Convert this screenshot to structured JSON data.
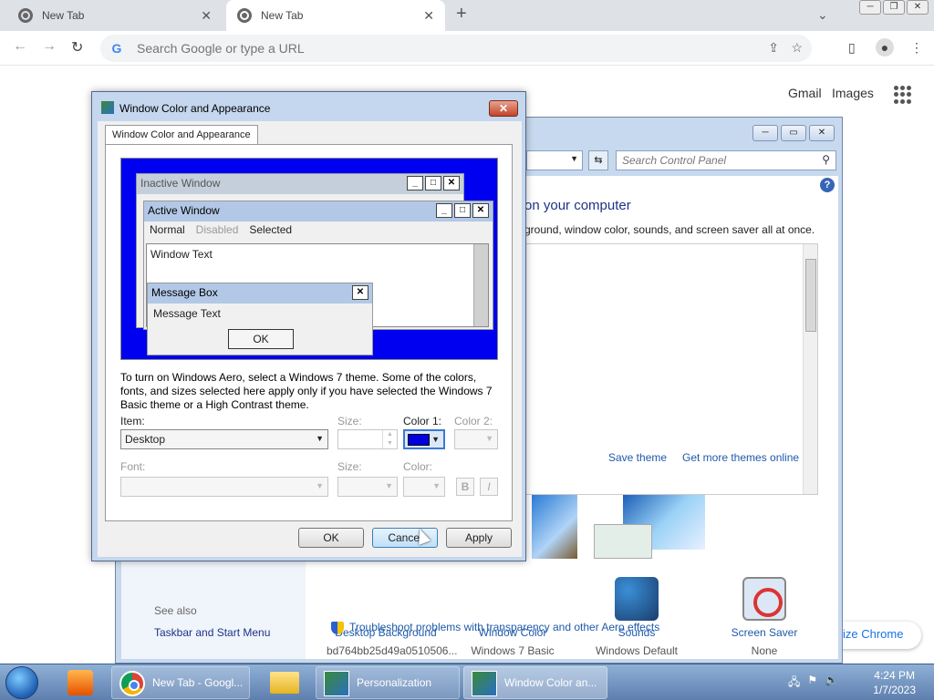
{
  "browser": {
    "tabs": [
      {
        "label": "New Tab"
      },
      {
        "label": "New Tab"
      }
    ],
    "omnibox_placeholder": "Search Google or type a URL",
    "gmail": "Gmail",
    "images": "Images",
    "customize": "ize Chrome"
  },
  "control_panel": {
    "search_placeholder": "Search Control Panel",
    "heading": "on your computer",
    "subheading": "ground, window color, sounds, and screen saver all at once.",
    "save_theme": "Save theme",
    "get_more": "Get more themes online",
    "items": [
      {
        "label": "Desktop Background",
        "value": "bd764bb25d49a0510506..."
      },
      {
        "label": "Window Color",
        "value": "Windows 7 Basic"
      },
      {
        "label": "Sounds",
        "value": "Windows Default"
      },
      {
        "label": "Screen Saver",
        "value": "None"
      }
    ],
    "see_also": "See also",
    "taskbar_link": "Taskbar and Start Menu",
    "troubleshoot": "Troubleshoot problems with transparency and other Aero effects"
  },
  "dialog": {
    "title": "Window Color and Appearance",
    "tab": "Window Color and Appearance",
    "preview": {
      "inactive": "Inactive Window",
      "active": "Active Window",
      "menu_normal": "Normal",
      "menu_disabled": "Disabled",
      "menu_selected": "Selected",
      "window_text": "Window Text",
      "message_box": "Message Box",
      "message_text": "Message Text",
      "ok": "OK"
    },
    "info": "To turn on Windows Aero, select a Windows 7 theme.  Some of the colors, fonts, and sizes selected here apply only if you have selected the Windows 7 Basic theme or a High Contrast theme.",
    "item_label": "Item:",
    "item_value": "Desktop",
    "size_label": "Size:",
    "color1_label": "Color 1:",
    "color2_label": "Color 2:",
    "font_label": "Font:",
    "size2_label": "Size:",
    "color_label": "Color:",
    "bold": "B",
    "italic": "I",
    "buttons": {
      "ok": "OK",
      "cancel": "Cancel",
      "apply": "Apply"
    },
    "color1": "#0000e0"
  },
  "taskbar": {
    "buttons": [
      {
        "label": "New Tab - Googl..."
      },
      {
        "label": "Personalization"
      },
      {
        "label": "Window Color an..."
      }
    ],
    "time": "4:24 PM",
    "date": "1/7/2023"
  }
}
